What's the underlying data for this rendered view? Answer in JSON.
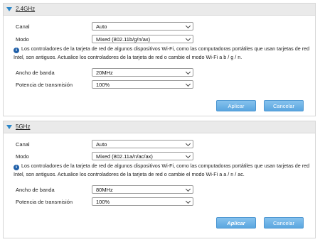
{
  "band_24": {
    "title": "2.4GHz",
    "canal_label": "Canal",
    "canal_value": "Auto",
    "modo_label": "Modo",
    "modo_value": "Mixed (802.11b/g/n/ax)",
    "note": "Los controladores de la tarjeta de red de algunos dispositivos Wi-Fi, como las computadoras portátiles que usan tarjetas de red Intel, son antiguos. Actualice los controladores de la tarjeta de red o cambie el modo Wi-Fi a b / g / n.",
    "bandwidth_label": "Ancho de banda",
    "bandwidth_value": "20MHz",
    "power_label": "Potencia de transmisión",
    "power_value": "100%",
    "apply_label": "Aplicar",
    "cancel_label": "Cancelar"
  },
  "band_5": {
    "title": "5GHz",
    "canal_label": "Canal",
    "canal_value": "Auto",
    "modo_label": "Modo",
    "modo_value": "Mixed (802.11a/n/ac/ax)",
    "note": "Los controladores de la tarjeta de red de algunos dispositivos Wi-Fi, como las computadoras portátiles que usan tarjetas de red Intel, son antiguos. Actualice los controladores de la tarjeta de red o cambie el modo Wi-Fi a a / n / ac.",
    "bandwidth_label": "Ancho de banda",
    "bandwidth_value": "80MHz",
    "power_label": "Potencia de transmisión",
    "power_value": "100%",
    "apply_label": "Aplicar",
    "cancel_label": "Cancelar"
  },
  "colors": {
    "accent": "#2a86c8",
    "button": "#6ab2e6",
    "info_icon": "#1f5fa8"
  },
  "icons": [
    "triangle-down-icon",
    "chevron-down-icon",
    "info-icon"
  ]
}
